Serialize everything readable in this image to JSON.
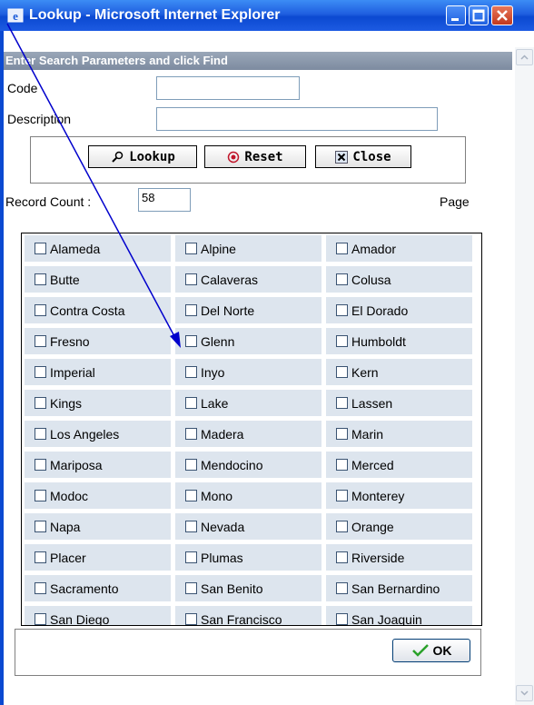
{
  "window": {
    "title": "Lookup - Microsoft Internet Explorer"
  },
  "params": {
    "header": "Enter Search Parameters and click Find",
    "code_label": "Code",
    "code_value": "",
    "description_label": "Description",
    "description_value": ""
  },
  "buttons": {
    "lookup": "Lookup",
    "reset": "Reset",
    "close": "Close",
    "ok": "OK"
  },
  "record": {
    "label": "Record Count :",
    "value": "58",
    "page_label": "Page"
  },
  "counties": [
    [
      "Alameda",
      "Alpine",
      "Amador"
    ],
    [
      "Butte",
      "Calaveras",
      "Colusa"
    ],
    [
      "Contra Costa",
      "Del Norte",
      "El Dorado"
    ],
    [
      "Fresno",
      "Glenn",
      "Humboldt"
    ],
    [
      "Imperial",
      "Inyo",
      "Kern"
    ],
    [
      "Kings",
      "Lake",
      "Lassen"
    ],
    [
      "Los Angeles",
      "Madera",
      "Marin"
    ],
    [
      "Mariposa",
      "Mendocino",
      "Merced"
    ],
    [
      "Modoc",
      "Mono",
      "Monterey"
    ],
    [
      "Napa",
      "Nevada",
      "Orange"
    ],
    [
      "Placer",
      "Plumas",
      "Riverside"
    ],
    [
      "Sacramento",
      "San Benito",
      "San Bernardino"
    ],
    [
      "San Diego",
      "San Francisco",
      "San Joaquin"
    ]
  ],
  "colors": {
    "titlebar": "#0b49d1",
    "header": "#8895a8",
    "cell": "#dde5ee",
    "annotation_arrow": "#0000cc"
  },
  "icons": [
    "ie-icon",
    "magnifier-icon",
    "reset-icon",
    "close-x-icon",
    "checkmark-icon",
    "arrow-annotation"
  ]
}
